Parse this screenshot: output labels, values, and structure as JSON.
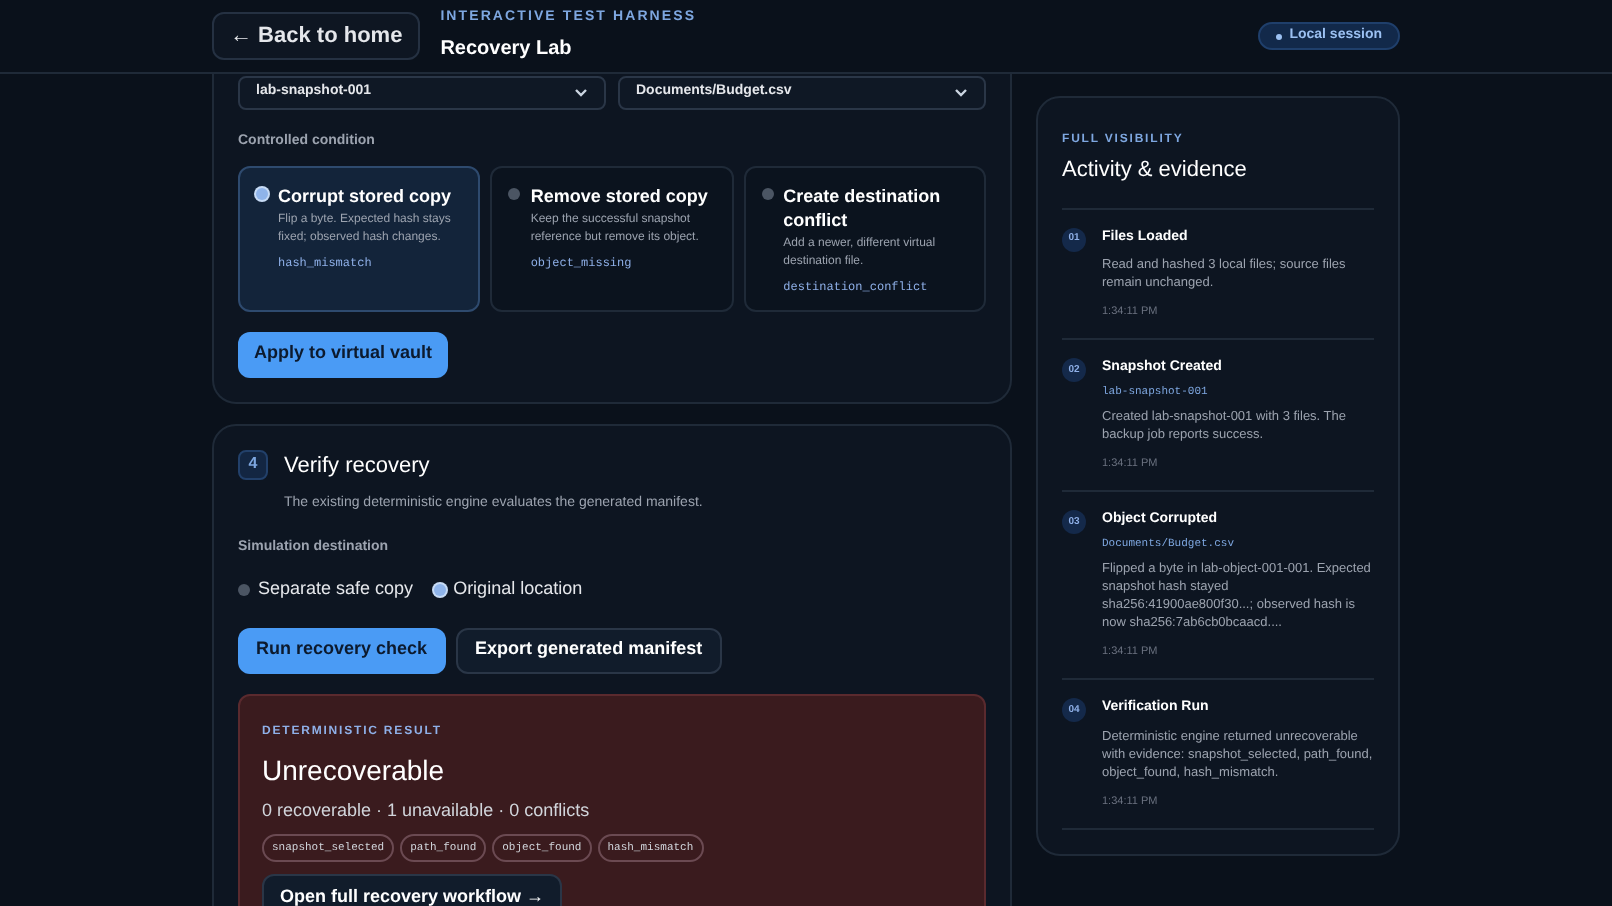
{
  "header": {
    "back_button": "← Back to home",
    "eyebrow": "INTERACTIVE TEST HARNESS",
    "title": "Recovery Lab",
    "session_badge": "Local session"
  },
  "condition_panel": {
    "selects": [
      "lab-snapshot-001",
      "Documents/Budget.csv"
    ],
    "label": "Controlled condition",
    "options": [
      {
        "title": "Corrupt stored copy",
        "description": "Flip a byte. Expected hash stays fixed; observed hash changes.",
        "code": "hash_mismatch",
        "selected": true
      },
      {
        "title": "Remove stored copy",
        "description": "Keep the successful snapshot reference but remove its object.",
        "code": "object_missing",
        "selected": false
      },
      {
        "title": "Create destination conflict",
        "description": "Add a newer, different virtual destination file.",
        "code": "destination_conflict",
        "selected": false
      }
    ],
    "apply_button": "Apply to virtual vault"
  },
  "verify_panel": {
    "step": "4",
    "title": "Verify recovery",
    "subtitle": "The existing deterministic engine evaluates the generated manifest.",
    "destination_label": "Simulation destination",
    "destinations": [
      {
        "label": "Separate safe copy",
        "selected": false
      },
      {
        "label": "Original location",
        "selected": true
      }
    ],
    "buttons": [
      {
        "label": "Run recovery check",
        "kind": "primary"
      },
      {
        "label": "Export generated manifest",
        "kind": "secondary"
      }
    ],
    "result": {
      "eyebrow": "DETERMINISTIC RESULT",
      "status": "Unrecoverable",
      "summary": "0 recoverable · 1 unavailable · 0 conflicts",
      "evidence": [
        "snapshot_selected",
        "path_found",
        "object_found",
        "hash_mismatch"
      ],
      "link": "Open full recovery workflow →"
    }
  },
  "activity": {
    "eyebrow": "FULL VISIBILITY",
    "title": "Activity & evidence",
    "events": [
      {
        "number": "01",
        "title": "Files Loaded",
        "description": "Read and hashed 3 local files; source files remain unchanged.",
        "time": "1:34:11 PM"
      },
      {
        "number": "02",
        "title": "Snapshot Created",
        "ref": "lab-snapshot-001",
        "description": "Created lab-snapshot-001 with 3 files. The backup job reports success.",
        "time": "1:34:11 PM"
      },
      {
        "number": "03",
        "title": "Object Corrupted",
        "ref": "Documents/Budget.csv",
        "description": "Flipped a byte in lab-object-001-001. Expected snapshot hash stayed sha256:41900ae800f30...; observed hash is now sha256:7ab6cb0bcaacd....",
        "time": "1:34:11 PM"
      },
      {
        "number": "04",
        "title": "Verification Run",
        "description": "Deterministic engine returned unrecoverable with evidence: snapshot_selected, path_found, object_found, hash_mismatch.",
        "time": "1:34:11 PM"
      }
    ]
  }
}
